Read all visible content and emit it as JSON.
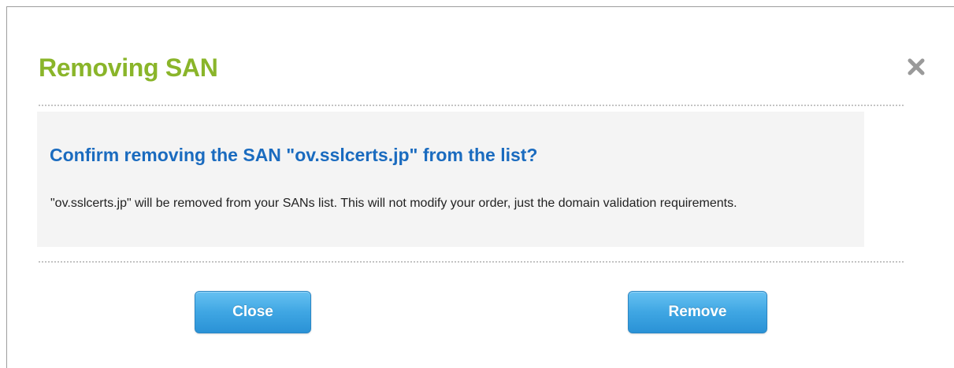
{
  "dialog": {
    "title": "Removing SAN",
    "close_icon": "close-x-icon",
    "message": {
      "question": "Confirm removing the SAN \"ov.sslcerts.jp\" from the list?",
      "detail": "\"ov.sslcerts.jp\" will be removed from your SANs list. This will not modify your order, just the domain validation requirements."
    },
    "buttons": {
      "close_label": "Close",
      "remove_label": "Remove"
    }
  },
  "colors": {
    "title": "#8ab52a",
    "question": "#1a6bbf",
    "button_top": "#66c1f2",
    "button_bottom": "#2a92d6",
    "message_bg": "#f4f4f4"
  }
}
